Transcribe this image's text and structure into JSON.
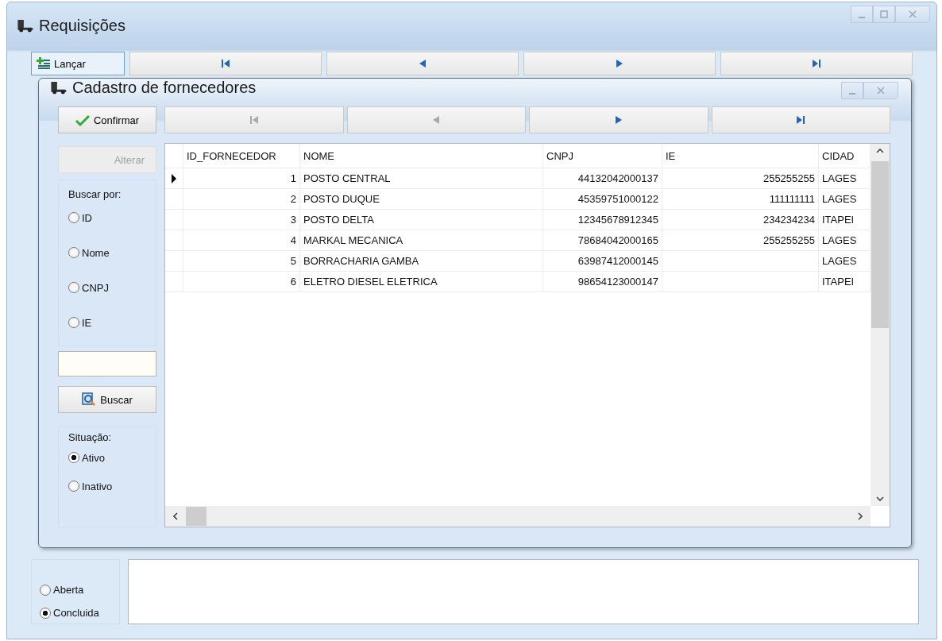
{
  "window": {
    "title": "Requisições"
  },
  "toolbar": {
    "launch_button": "Lançar",
    "nav": [
      {
        "kind": "first",
        "disabled": false
      },
      {
        "kind": "prev",
        "disabled": false
      },
      {
        "kind": "next",
        "disabled": false
      },
      {
        "kind": "last",
        "disabled": false
      }
    ]
  },
  "status_group": {
    "options": [
      {
        "label": "Aberta",
        "selected": false
      },
      {
        "label": "Concluida",
        "selected": true
      }
    ]
  },
  "dialog": {
    "title": "Cadastro de fornecedores",
    "confirm_button": "Confirmar",
    "edit_button": {
      "label": "Alterar",
      "disabled": true
    },
    "nav": [
      {
        "kind": "first",
        "disabled": true
      },
      {
        "kind": "prev",
        "disabled": true
      },
      {
        "kind": "next",
        "disabled": false
      },
      {
        "kind": "last",
        "disabled": false
      }
    ],
    "search_by": {
      "label": "Buscar por:",
      "options": [
        {
          "label": "ID",
          "selected": false
        },
        {
          "label": "Nome",
          "selected": false
        },
        {
          "label": "CNPJ",
          "selected": false
        },
        {
          "label": "IE",
          "selected": false
        }
      ]
    },
    "search_button": "Buscar",
    "situation": {
      "label": "Situação:",
      "options": [
        {
          "label": "Ativo",
          "selected": true
        },
        {
          "label": "Inativo",
          "selected": false
        }
      ]
    },
    "grid": {
      "columns": [
        "ID_FORNECEDOR",
        "NOME",
        "CNPJ",
        "IE",
        "CIDAD"
      ],
      "rows": [
        {
          "current": true,
          "cells": [
            "1",
            "POSTO CENTRAL",
            "44132042000137",
            "255255255",
            "LAGES"
          ]
        },
        {
          "current": false,
          "cells": [
            "2",
            "POSTO DUQUE",
            "45359751000122",
            "111111111",
            "LAGES"
          ]
        },
        {
          "current": false,
          "cells": [
            "3",
            "POSTO DELTA",
            "12345678912345",
            "234234234",
            "ITAPEI"
          ]
        },
        {
          "current": false,
          "cells": [
            "4",
            "MARKAL MECANICA",
            "78684042000165",
            "255255255",
            "LAGES"
          ]
        },
        {
          "current": false,
          "cells": [
            "5",
            "BORRACHARIA GAMBA",
            "63987412000145",
            null,
            "LAGES"
          ]
        },
        {
          "current": false,
          "cells": [
            "6",
            "ELETRO DIESEL ELETRICA",
            "98654123000147",
            null,
            "ITAPEI"
          ]
        }
      ]
    }
  }
}
